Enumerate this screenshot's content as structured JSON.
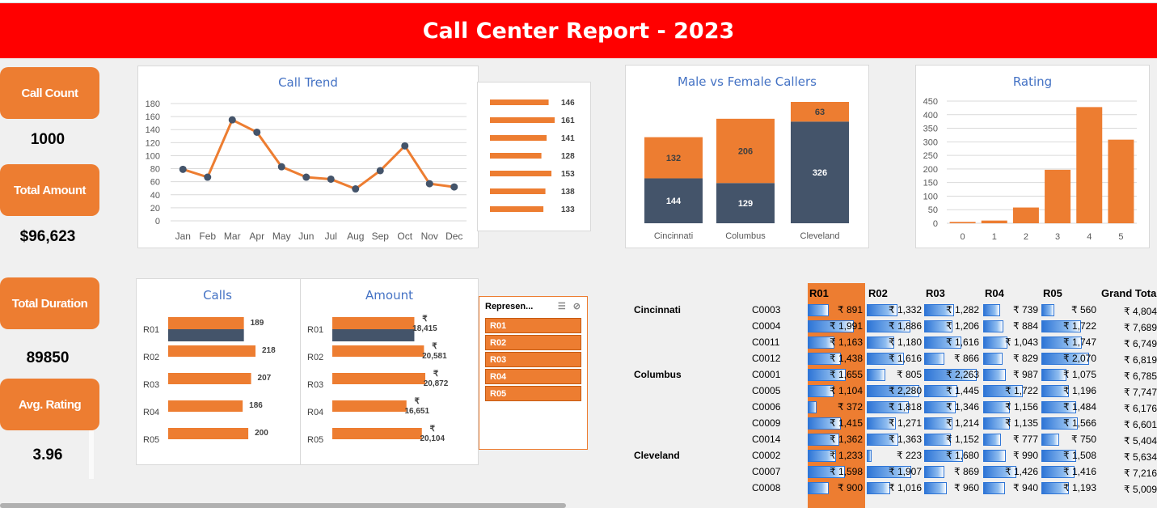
{
  "title": "Call Center Report - 2023",
  "kpis": {
    "call_count_label": "Call Count",
    "call_count": "1000",
    "total_amount_label": "Total Amount",
    "total_amount": "$96,623",
    "total_duration_label": "Total Duration",
    "total_duration": "89850",
    "avg_rating_label": "Avg. Rating",
    "avg_rating": "3.96"
  },
  "colors": {
    "orange": "#ed7d31",
    "navy": "#44546a",
    "title_blue": "#4472c4",
    "banner_red": "#ff0000"
  },
  "slicer": {
    "title": "Represen...",
    "items": [
      "R01",
      "R02",
      "R03",
      "R04",
      "R05"
    ]
  },
  "chart_data": [
    {
      "type": "line",
      "title": "Call Trend",
      "categories": [
        "Jan",
        "Feb",
        "Mar",
        "Apr",
        "May",
        "Jun",
        "Jul",
        "Aug",
        "Sep",
        "Oct",
        "Nov",
        "Dec"
      ],
      "values": [
        79,
        67,
        155,
        136,
        83,
        67,
        64,
        49,
        77,
        115,
        57,
        52
      ],
      "yticks": [
        "0",
        "20",
        "40",
        "60",
        "80",
        "100",
        "120",
        "140",
        "160",
        "180"
      ],
      "ylim": [
        0,
        180
      ],
      "grid": true
    },
    {
      "type": "bar",
      "orientation": "horizontal",
      "values": [
        146,
        161,
        141,
        128,
        153,
        138,
        133
      ]
    },
    {
      "type": "bar",
      "stacked": true,
      "title": "Male vs Female Callers",
      "categories": [
        "Cincinnati",
        "Columbus",
        "Cleveland"
      ],
      "series": [
        {
          "values": [
            144,
            129,
            326
          ],
          "color": "#44546a"
        },
        {
          "values": [
            132,
            206,
            63
          ],
          "color": "#ed7d31"
        }
      ]
    },
    {
      "type": "bar",
      "title": "Rating",
      "categories": [
        "0",
        "1",
        "2",
        "3",
        "4",
        "5"
      ],
      "values": [
        5,
        10,
        58,
        197,
        428,
        308
      ],
      "yticks": [
        "0",
        "50",
        "100",
        "150",
        "200",
        "250",
        "300",
        "350",
        "400",
        "450"
      ],
      "ylim": [
        0,
        450
      ],
      "grid": true
    },
    {
      "type": "bar",
      "orientation": "horizontal",
      "title": "Calls",
      "categories": [
        "R01",
        "R02",
        "R03",
        "R04",
        "R05"
      ],
      "values": [
        189,
        218,
        207,
        186,
        200
      ],
      "value_labels": [
        "189",
        "218",
        "207",
        "186",
        "200"
      ]
    },
    {
      "type": "bar",
      "orientation": "horizontal",
      "title": "Amount",
      "categories": [
        "R01",
        "R02",
        "R03",
        "R04",
        "R05"
      ],
      "values": [
        18415,
        20581,
        20872,
        16651,
        20104
      ],
      "value_labels": [
        "18,415",
        "20,581",
        "20,872",
        "16,651",
        "20,104"
      ],
      "currency": "₹"
    }
  ],
  "pivot": {
    "headers": [
      "R01",
      "R02",
      "R03",
      "R04",
      "R05",
      "Grand Tota"
    ],
    "rows": [
      {
        "city": "Cincinnati",
        "code": "C0003",
        "vals": [
          891,
          1332,
          1282,
          739,
          560
        ],
        "labels": [
          "₹ 891",
          "₹ 1,332",
          "₹ 1,282",
          "₹ 739",
          "₹ 560"
        ],
        "total": "₹ 4,804"
      },
      {
        "city": "",
        "code": "C0004",
        "vals": [
          1991,
          1886,
          1206,
          884,
          1722
        ],
        "labels": [
          "₹ 1,991",
          "₹ 1,886",
          "₹ 1,206",
          "₹ 884",
          "₹ 1,722"
        ],
        "total": "₹ 7,689"
      },
      {
        "city": "",
        "code": "C0011",
        "vals": [
          1163,
          1180,
          1616,
          1043,
          1747
        ],
        "labels": [
          "₹ 1,163",
          "₹ 1,180",
          "₹ 1,616",
          "₹ 1,043",
          "₹ 1,747"
        ],
        "total": "₹ 6,749"
      },
      {
        "city": "",
        "code": "C0012",
        "vals": [
          1438,
          1616,
          866,
          829,
          2070
        ],
        "labels": [
          "₹ 1,438",
          "₹ 1,616",
          "₹ 866",
          "₹ 829",
          "₹ 2,070"
        ],
        "total": "₹ 6,819"
      },
      {
        "city": "Columbus",
        "code": "C0001",
        "vals": [
          1655,
          805,
          2263,
          987,
          1075
        ],
        "labels": [
          "₹ 1,655",
          "₹ 805",
          "₹ 2,263",
          "₹ 987",
          "₹ 1,075"
        ],
        "total": "₹ 6,785"
      },
      {
        "city": "",
        "code": "C0005",
        "vals": [
          1104,
          2280,
          1445,
          1722,
          1196
        ],
        "labels": [
          "₹ 1,104",
          "₹ 2,280",
          "₹ 1,445",
          "₹ 1,722",
          "₹ 1,196"
        ],
        "total": "₹ 7,747"
      },
      {
        "city": "",
        "code": "C0006",
        "vals": [
          372,
          1818,
          1346,
          1156,
          1484
        ],
        "labels": [
          "₹ 372",
          "₹ 1,818",
          "₹ 1,346",
          "₹ 1,156",
          "₹ 1,484"
        ],
        "total": "₹ 6,176"
      },
      {
        "city": "",
        "code": "C0009",
        "vals": [
          1415,
          1271,
          1214,
          1135,
          1566
        ],
        "labels": [
          "₹ 1,415",
          "₹ 1,271",
          "₹ 1,214",
          "₹ 1,135",
          "₹ 1,566"
        ],
        "total": "₹ 6,601"
      },
      {
        "city": "",
        "code": "C0014",
        "vals": [
          1362,
          1363,
          1152,
          777,
          750
        ],
        "labels": [
          "₹ 1,362",
          "₹ 1,363",
          "₹ 1,152",
          "₹ 777",
          "₹ 750"
        ],
        "total": "₹ 5,404"
      },
      {
        "city": "Cleveland",
        "code": "C0002",
        "vals": [
          1233,
          223,
          1680,
          990,
          1508
        ],
        "labels": [
          "₹ 1,233",
          "₹ 223",
          "₹ 1,680",
          "₹ 990",
          "₹ 1,508"
        ],
        "total": "₹ 5,634"
      },
      {
        "city": "",
        "code": "C0007",
        "vals": [
          1598,
          1907,
          869,
          1426,
          1416
        ],
        "labels": [
          "₹ 1,598",
          "₹ 1,907",
          "₹ 869",
          "₹ 1,426",
          "₹ 1,416"
        ],
        "total": "₹ 7,216"
      },
      {
        "city": "",
        "code": "C0008",
        "vals": [
          900,
          1016,
          960,
          940,
          1193
        ],
        "labels": [
          "₹ 900",
          "₹ 1,016",
          "₹ 960",
          "₹ 940",
          "₹ 1,193"
        ],
        "total": "₹ 5,009"
      }
    ],
    "max_value": 2300
  }
}
